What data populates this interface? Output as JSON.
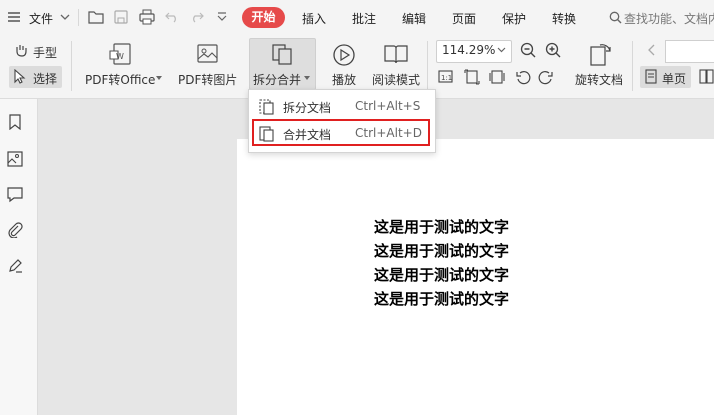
{
  "menubar": {
    "file_label": "文件",
    "tabs": [
      {
        "label": "开始"
      },
      {
        "label": "插入"
      },
      {
        "label": "批注"
      },
      {
        "label": "编辑"
      },
      {
        "label": "页面"
      },
      {
        "label": "保护"
      },
      {
        "label": "转换"
      }
    ],
    "search_placeholder": "查找功能、文档内"
  },
  "ribbon": {
    "hand_tool": "手型",
    "select_tool": "选择",
    "pdf_to_office": "PDF转Office",
    "pdf_to_image": "PDF转图片",
    "split_merge": "拆分合并",
    "play": "播放",
    "read_mode": "阅读模式",
    "zoom": "114.29%",
    "rotate_doc": "旋转文档",
    "single_page": "单页"
  },
  "dropdown": {
    "items": [
      {
        "label": "拆分文档",
        "shortcut": "Ctrl+Alt+S"
      },
      {
        "label": "合并文档",
        "shortcut": "Ctrl+Alt+D"
      }
    ]
  },
  "document": {
    "lines": [
      "这是用于测试的文字",
      "这是用于测试的文字",
      "这是用于测试的文字",
      "这是用于测试的文字"
    ]
  },
  "colors": {
    "accent": "#e64a4a",
    "highlight_border": "#e02020"
  }
}
